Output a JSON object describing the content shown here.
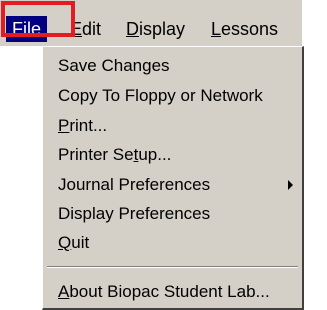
{
  "menubar": {
    "items": [
      {
        "mnemonic": "F",
        "rest": "ile"
      },
      {
        "mnemonic": "E",
        "rest": "dit"
      },
      {
        "mnemonic": "D",
        "rest": "isplay"
      },
      {
        "mnemonic": "L",
        "rest": "essons"
      }
    ]
  },
  "file_menu": {
    "items": [
      {
        "label": "Save Changes"
      },
      {
        "label": "Copy To Floppy or Network"
      },
      {
        "pre": "",
        "mnemonic": "P",
        "rest": "rint..."
      },
      {
        "pre": "Printer Se",
        "mnemonic": "t",
        "rest": "up..."
      },
      {
        "label": "Journal Preferences",
        "submenu_icon": "triangle-right-icon"
      },
      {
        "label": "Display Preferences"
      },
      {
        "pre": "",
        "mnemonic": "Q",
        "rest": "uit"
      },
      {
        "pre": "",
        "mnemonic": "A",
        "rest": "bout Biopac Student Lab..."
      }
    ]
  },
  "colors": {
    "menu_background": "#d4d0c8",
    "selection": "#000080",
    "callout": "#e31b23"
  }
}
